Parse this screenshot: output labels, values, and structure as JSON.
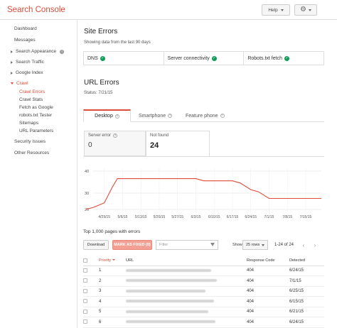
{
  "header": {
    "brand": "Search Console",
    "help_label": "Help",
    "settings_icon": "gear-icon"
  },
  "sidebar": {
    "items": [
      {
        "label": "Dashboard"
      },
      {
        "label": "Messages"
      },
      {
        "label": "Search Appearance"
      },
      {
        "label": "Search Traffic"
      },
      {
        "label": "Google Index"
      },
      {
        "label": "Crawl"
      },
      {
        "label": "Crawl Errors"
      },
      {
        "label": "Crawl Stats"
      },
      {
        "label": "Fetch as Google"
      },
      {
        "label": "robots.txt Tester"
      },
      {
        "label": "Sitemaps"
      },
      {
        "label": "URL Parameters"
      },
      {
        "label": "Security Issues"
      },
      {
        "label": "Other Resources"
      }
    ]
  },
  "site_errors": {
    "title": "Site Errors",
    "subtitle": "Showing data from the last 90 days",
    "cells": [
      {
        "label": "DNS",
        "status_color": "#0f9d58"
      },
      {
        "label": "Server connectivity",
        "status_color": "#0f9d58"
      },
      {
        "label": "Robots.txt fetch",
        "status_color": "#0f9d58"
      }
    ]
  },
  "url_errors": {
    "title": "URL Errors",
    "status": "Status: 7/21/15",
    "tabs": [
      {
        "label": "Desktop",
        "active": true
      },
      {
        "label": "Smartphone",
        "active": false
      },
      {
        "label": "Feature phone",
        "active": false
      }
    ],
    "counters": [
      {
        "label": "Server error",
        "value": "0"
      },
      {
        "label": "Not found",
        "value": "24"
      }
    ]
  },
  "chart_data": {
    "type": "line",
    "x": [
      "4/29/15",
      "5/6/15",
      "5/13/15",
      "5/20/15",
      "5/27/15",
      "6/3/15",
      "6/10/15",
      "6/17/15",
      "6/24/15",
      "7/1/15",
      "7/8/15",
      "7/15/15"
    ],
    "series": [
      {
        "color": "#dd4b39",
        "points": [
          [
            "4/22/15",
            20
          ],
          [
            "4/25/15",
            21
          ],
          [
            "4/29/15",
            23
          ],
          [
            "5/2/15",
            30
          ],
          [
            "5/4/15",
            34
          ],
          [
            "5/6/15",
            34
          ],
          [
            "5/13/15",
            34
          ],
          [
            "5/20/15",
            34
          ],
          [
            "5/27/15",
            34
          ],
          [
            "6/3/15",
            34
          ],
          [
            "6/6/15",
            33
          ],
          [
            "6/10/15",
            33
          ],
          [
            "6/17/15",
            33
          ],
          [
            "6/20/15",
            32
          ],
          [
            "6/24/15",
            29
          ],
          [
            "6/27/15",
            28
          ],
          [
            "7/1/15",
            25
          ],
          [
            "7/8/15",
            25
          ],
          [
            "7/15/15",
            25
          ],
          [
            "7/21/15",
            25
          ]
        ]
      }
    ],
    "y_ticks": [
      20,
      30,
      40
    ],
    "ylim": [
      20,
      40
    ],
    "grid": true
  },
  "table": {
    "title": "Top 1,000 pages with errors",
    "download_label": "Download",
    "mark_fixed_label": "MARK AS FIXED (0)",
    "filter_placeholder": "Filter",
    "show_label": "Show",
    "rows_select": "25 rows",
    "pager_text": "1-24 of 24",
    "columns": [
      "Priority",
      "URL",
      "Response Code",
      "Detected"
    ],
    "rows": [
      {
        "priority": "1",
        "code": "404",
        "detected": "6/24/15"
      },
      {
        "priority": "2",
        "code": "404",
        "detected": "7/1/15"
      },
      {
        "priority": "3",
        "code": "404",
        "detected": "6/25/15"
      },
      {
        "priority": "4",
        "code": "404",
        "detected": "6/15/15"
      },
      {
        "priority": "5",
        "code": "404",
        "detected": "6/21/15"
      },
      {
        "priority": "6",
        "code": "404",
        "detected": "6/24/15"
      }
    ]
  }
}
